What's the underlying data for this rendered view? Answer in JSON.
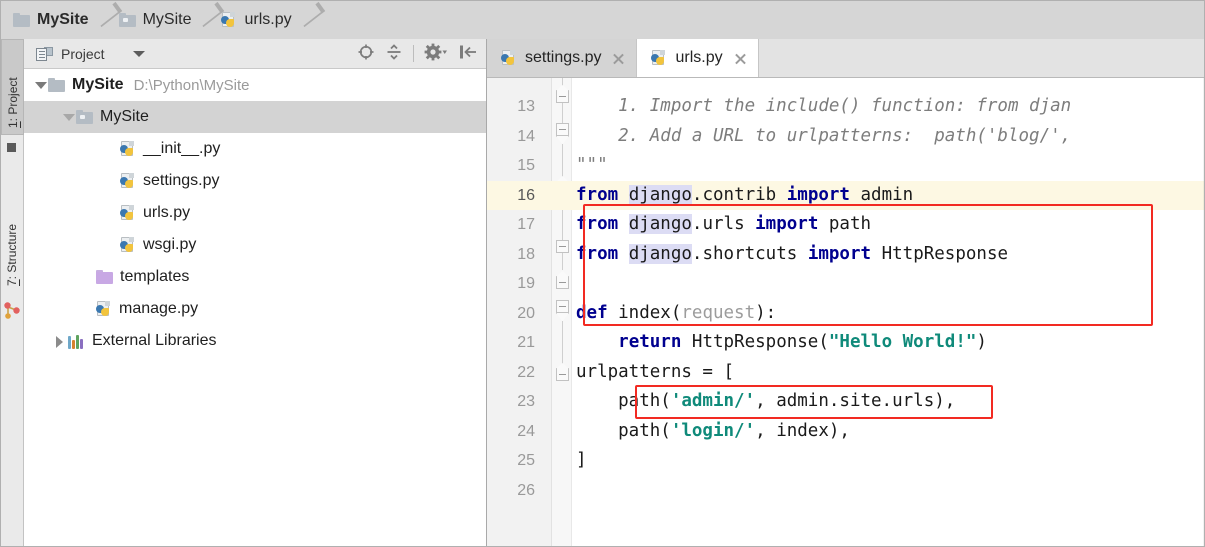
{
  "window": {
    "app": "PyCharm",
    "accent_red": "#f22a22",
    "keyword_color": "#00008f",
    "string_color": "#0f8a7a"
  },
  "breadcrumb": {
    "items": [
      {
        "label": "MySite",
        "icon": "folder-icon",
        "bold": true
      },
      {
        "label": "MySite",
        "icon": "folder-open-icon",
        "bold": false
      },
      {
        "label": "urls.py",
        "icon": "python-file-icon",
        "bold": false
      }
    ]
  },
  "tool_strip": {
    "tabs": [
      {
        "num": "1",
        "label": "Project",
        "active": true
      },
      {
        "num": "7",
        "label": "Structure",
        "active": false
      }
    ]
  },
  "project_panel": {
    "title": "Project",
    "dropdown_icon": "chevron-down-icon",
    "toolbar": [
      {
        "name": "locate-target-icon",
        "tooltip": "Select Opened File"
      },
      {
        "name": "collapse-all-icon",
        "tooltip": "Collapse All"
      },
      {
        "name": "settings-gear-icon",
        "tooltip": "Settings"
      },
      {
        "name": "hide-panel-icon",
        "tooltip": "Hide"
      }
    ],
    "tree": [
      {
        "label": "MySite",
        "path": "D:\\Python\\MySite",
        "icon": "folder-icon",
        "arrow": "down",
        "bold": true,
        "indent": 0,
        "selected": false
      },
      {
        "label": "MySite",
        "path": "",
        "icon": "folder-open-icon",
        "arrow": "down",
        "bold": false,
        "indent": 1,
        "selected": true
      },
      {
        "label": "__init__.py",
        "path": "",
        "icon": "python-file-icon",
        "arrow": "none",
        "bold": false,
        "indent": 2,
        "selected": false
      },
      {
        "label": "settings.py",
        "path": "",
        "icon": "python-file-icon",
        "arrow": "none",
        "bold": false,
        "indent": 2,
        "selected": false
      },
      {
        "label": "urls.py",
        "path": "",
        "icon": "python-file-icon",
        "arrow": "none",
        "bold": false,
        "indent": 2,
        "selected": false
      },
      {
        "label": "wsgi.py",
        "path": "",
        "icon": "python-file-icon",
        "arrow": "none",
        "bold": false,
        "indent": 2,
        "selected": false
      },
      {
        "label": "templates",
        "path": "",
        "icon": "folder-purple-icon",
        "arrow": "none",
        "bold": false,
        "indent": 1,
        "selected": false
      },
      {
        "label": "manage.py",
        "path": "",
        "icon": "python-file-icon",
        "arrow": "none",
        "bold": false,
        "indent": 1,
        "selected": false
      },
      {
        "label": "External Libraries",
        "path": "",
        "icon": "library-icon",
        "arrow": "right",
        "bold": false,
        "indent": 0,
        "selected": false
      }
    ]
  },
  "editor": {
    "tabs": [
      {
        "label": "settings.py",
        "icon": "python-file-icon",
        "active": false,
        "close_icon": "close-icon"
      },
      {
        "label": "urls.py",
        "icon": "python-file-icon",
        "active": true,
        "close_icon": "close-icon"
      }
    ],
    "file": "urls.py",
    "current_line": 16,
    "first_visible_line": 13,
    "last_visible_line": 26,
    "lines": [
      {
        "n": 13,
        "text": "    1. Import the include() function: from djan",
        "style": "doc"
      },
      {
        "n": 14,
        "text": "    2. Add a URL to urlpatterns:  path('blog/',",
        "style": "doc"
      },
      {
        "n": 15,
        "text": "\"\"\"",
        "style": "doc"
      },
      {
        "n": 16,
        "text": "from django.contrib import admin",
        "style": "code"
      },
      {
        "n": 17,
        "text": "from django.urls import path",
        "style": "code"
      },
      {
        "n": 18,
        "text": "from django.shortcuts import HttpResponse",
        "style": "code"
      },
      {
        "n": 19,
        "text": "",
        "style": "code"
      },
      {
        "n": 20,
        "text": "def index(request):",
        "style": "code"
      },
      {
        "n": 21,
        "text": "    return HttpResponse(\"Hello World!\")",
        "style": "code"
      },
      {
        "n": 22,
        "text": "urlpatterns = [",
        "style": "code"
      },
      {
        "n": 23,
        "text": "    path('admin/', admin.site.urls),",
        "style": "code"
      },
      {
        "n": 24,
        "text": "    path('login/', index),",
        "style": "code"
      },
      {
        "n": 25,
        "text": "]",
        "style": "code"
      },
      {
        "n": 26,
        "text": "",
        "style": "code"
      }
    ],
    "annotations": [
      {
        "name": "annotation-box-import-and-view",
        "lines": "18-21"
      },
      {
        "name": "annotation-box-login-route",
        "lines": "24"
      }
    ]
  }
}
